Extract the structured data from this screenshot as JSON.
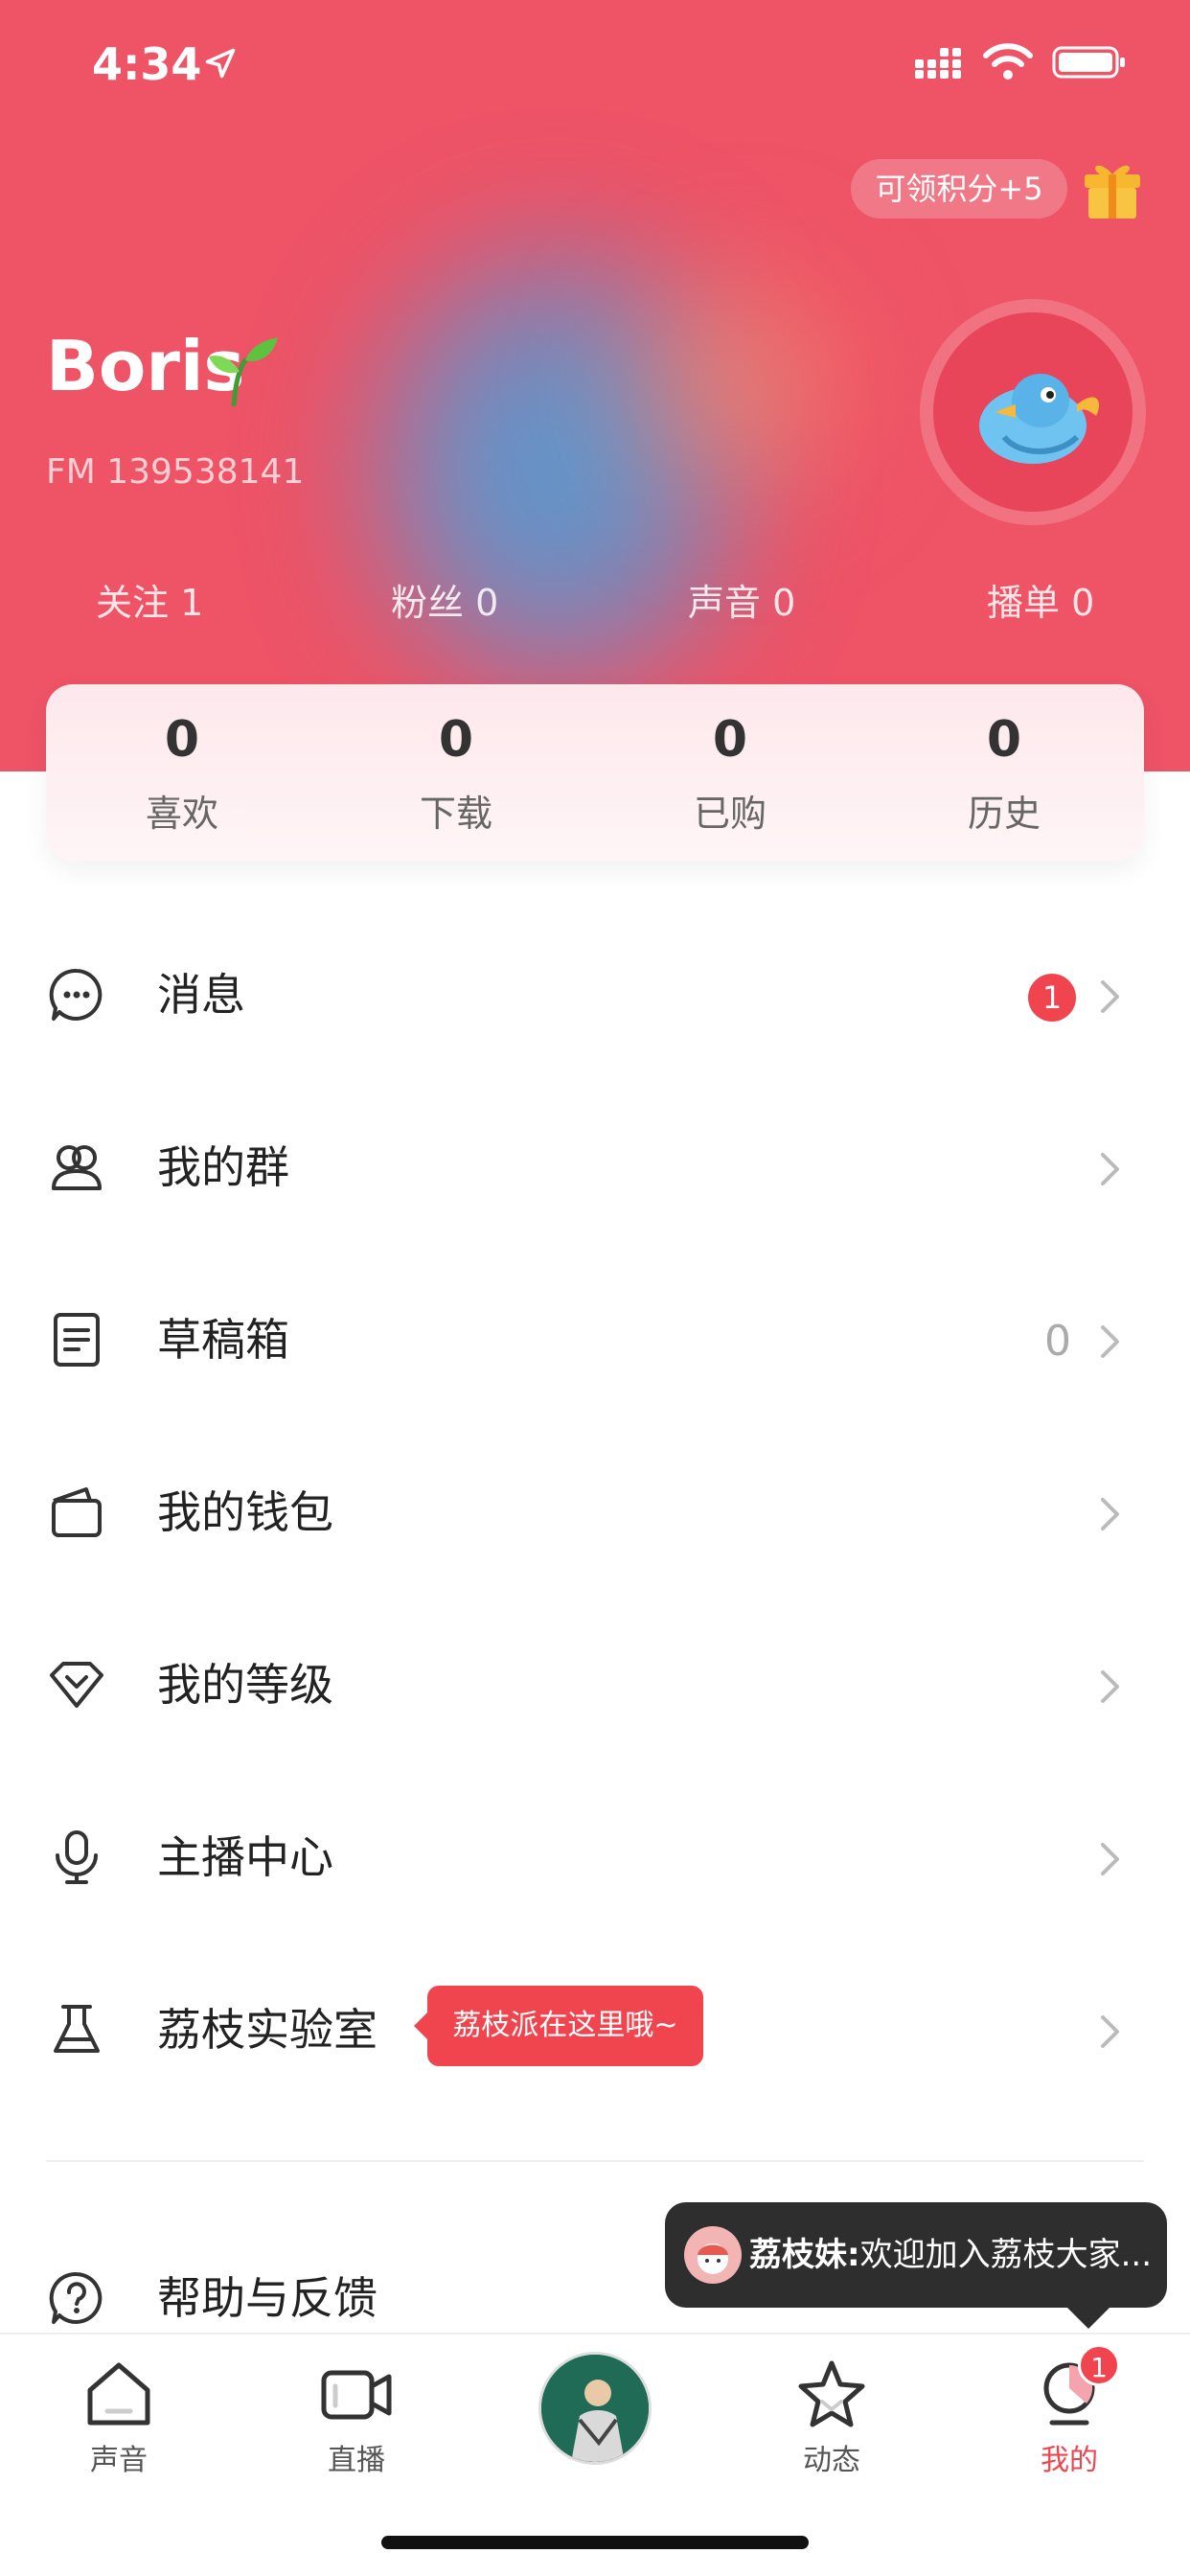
{
  "status_bar": {
    "time": "4:34"
  },
  "header": {
    "points_pill": "可领积分+5",
    "username": "Boris",
    "fm_id": "FM 139538141",
    "stats": [
      {
        "label": "关注 1"
      },
      {
        "label": "粉丝 0"
      },
      {
        "label": "声音 0"
      },
      {
        "label": "播单 0"
      }
    ]
  },
  "card": {
    "items": [
      {
        "value": "0",
        "label": "喜欢"
      },
      {
        "value": "0",
        "label": "下载"
      },
      {
        "value": "0",
        "label": "已购"
      },
      {
        "value": "0",
        "label": "历史"
      }
    ]
  },
  "menu": {
    "items": [
      {
        "label": "消息",
        "icon": "message-icon",
        "badge": "1"
      },
      {
        "label": "我的群",
        "icon": "group-icon"
      },
      {
        "label": "草稿箱",
        "icon": "drafts-icon",
        "count": "0"
      },
      {
        "label": "我的钱包",
        "icon": "wallet-icon"
      },
      {
        "label": "我的等级",
        "icon": "level-icon"
      },
      {
        "label": "主播中心",
        "icon": "microphone-icon"
      },
      {
        "label": "荔枝实验室",
        "icon": "flask-icon",
        "tooltip": "荔枝派在这里哦~"
      },
      {
        "label": "帮助与反馈",
        "icon": "help-icon"
      }
    ]
  },
  "toast": {
    "name": "荔枝妹:",
    "message": "欢迎加入荔枝大家..."
  },
  "tabbar": {
    "tabs": [
      {
        "label": "声音",
        "icon": "home-icon"
      },
      {
        "label": "直播",
        "icon": "video-icon"
      },
      {
        "label": "",
        "icon": "center-avatar"
      },
      {
        "label": "动态",
        "icon": "star-icon"
      },
      {
        "label": "我的",
        "icon": "profile-icon",
        "badge": "1"
      }
    ]
  },
  "colors": {
    "header": "#ee5366",
    "accent": "#f0454f",
    "toast": "#2e2e2e"
  }
}
